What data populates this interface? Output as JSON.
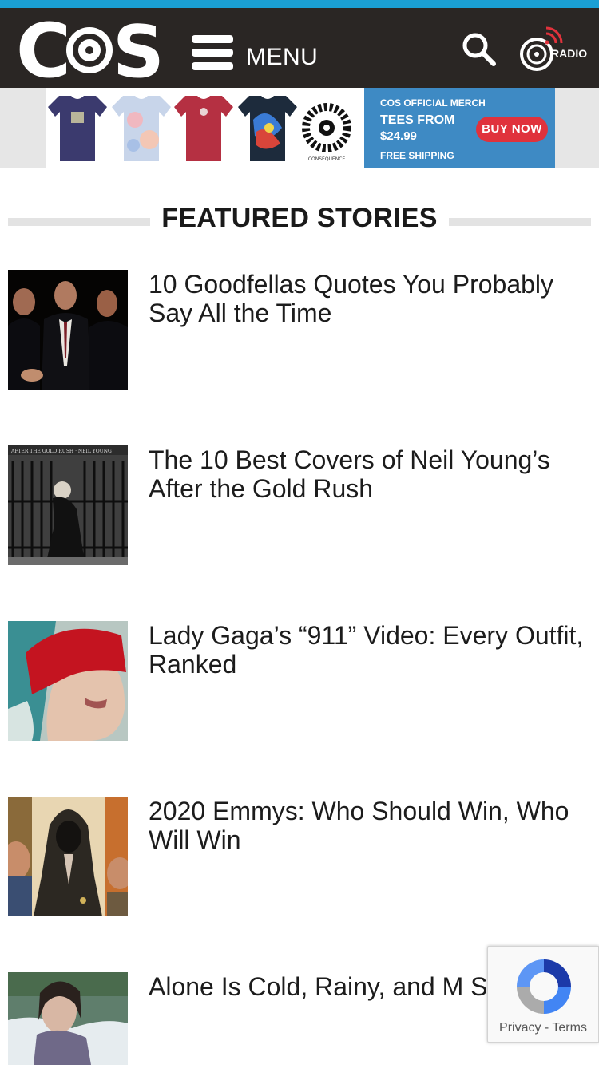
{
  "header": {
    "logo_text": "CoS",
    "menu_label": "MENU",
    "radio_label": "RADIO",
    "accent_color": "#1a9fd4",
    "background_color": "#2a2624"
  },
  "ad": {
    "brand_text": "CONSEQUENCE",
    "headline": "COS OFFICIAL MERCH",
    "line1": "TEES FROM",
    "price": "$24.99",
    "cta": "BUY NOW",
    "footer": "FREE SHIPPING"
  },
  "section": {
    "title": "FEATURED STORIES"
  },
  "stories": [
    {
      "title": "10 Goodfellas Quotes You Probably Say All the Time"
    },
    {
      "title": "The 10 Best Covers of Neil Young’s After the Gold Rush",
      "album_text": "AFTER THE GOLD RUSH · NEIL YOUNG"
    },
    {
      "title": "Lady Gaga’s “911” Video: Every Outfit, Ranked"
    },
    {
      "title": "2020 Emmys: Who Should Win, Who Will Win"
    },
    {
      "title": "Alone Is Cold, Rainy, and M Survival Horror: Review"
    }
  ],
  "recaptcha": {
    "privacy": "Privacy",
    "separator": " - ",
    "terms": "Terms"
  }
}
